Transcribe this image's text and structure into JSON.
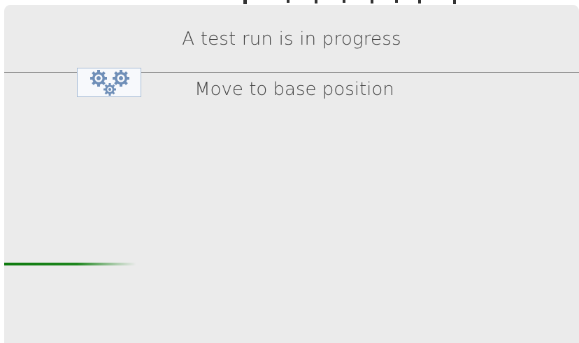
{
  "dialog": {
    "title": "A test run is in progress",
    "step_text": "Move to base position",
    "activity_icon": "gears-icon",
    "progress": 0.23
  },
  "colors": {
    "dialog_bg": "#ebebeb",
    "text": "#444444",
    "divider": "#7a7a7a",
    "progress": "#0e7a0e",
    "icon_blue": "#6f8fb8"
  }
}
